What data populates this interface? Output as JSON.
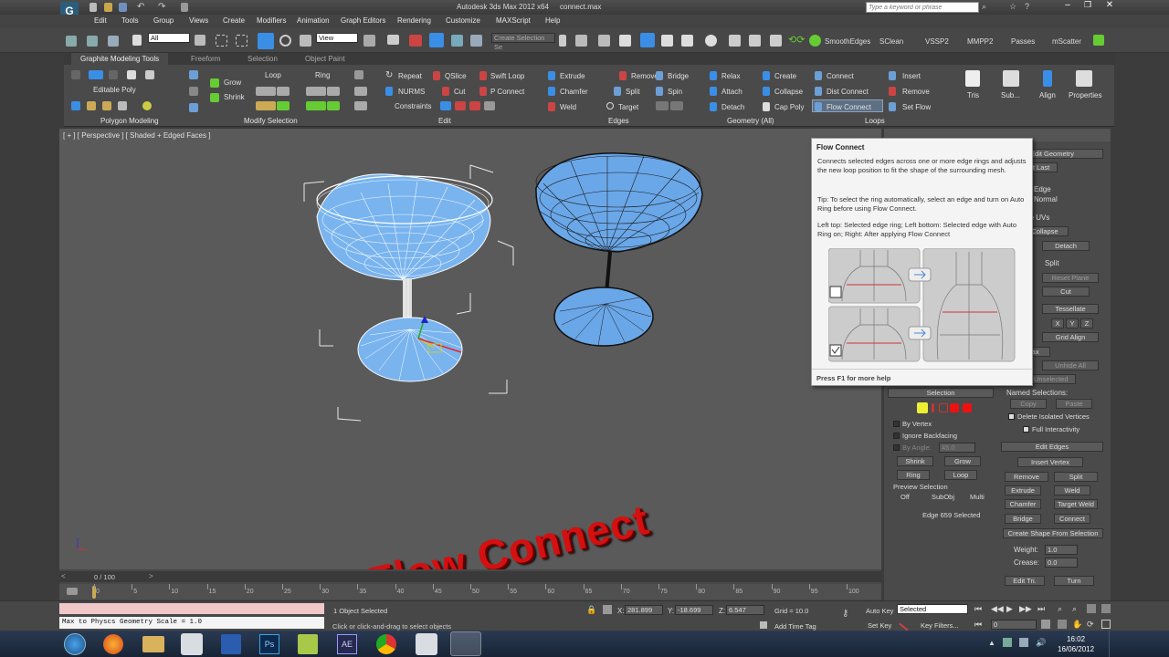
{
  "window": {
    "title": "Autodesk 3ds Max 2012 x64",
    "file": "connect.max",
    "search_placeholder": "Type a keyword or phrase"
  },
  "menu": [
    "Edit",
    "Tools",
    "Group",
    "Views",
    "Create",
    "Modifiers",
    "Animation",
    "Graph Editors",
    "Rendering",
    "Customize",
    "MAXScript",
    "Help"
  ],
  "toolbar": {
    "select_filter": "All",
    "ref_coord": "View",
    "named_sel": "Create Selection Se",
    "plugins": [
      "SmoothEdges",
      "SClean",
      "VSSP2",
      "MMPP2",
      "Passes",
      "mScatter"
    ]
  },
  "ribbon": {
    "tabs": [
      "Graphite Modeling Tools",
      "Freeform",
      "Selection",
      "Object Paint"
    ],
    "polygon_modeling": {
      "label": "Editable Poly",
      "group": "Polygon Modeling"
    },
    "modify_selection": {
      "grow": "Grow",
      "shrink": "Shrink",
      "loop": "Loop",
      "ring": "Ring",
      "group": "Modify Selection"
    },
    "edit": {
      "repeat": "Repeat",
      "qslice": "QSlice",
      "swift_loop": "Swift Loop",
      "nurms": "NURMS",
      "cut": "Cut",
      "p_connect": "P Connect",
      "constraints": "Constraints",
      "group": "Edit"
    },
    "edges": {
      "extrude": "Extrude",
      "remove": "Remove",
      "bridge": "Bridge",
      "chamfer": "Chamfer",
      "split": "Split",
      "spin": "Spin",
      "weld": "Weld",
      "target": "Target",
      "group": "Edges"
    },
    "geometry": {
      "relax": "Relax",
      "create": "Create",
      "attach": "Attach",
      "collapse": "Collapse",
      "detach": "Detach",
      "cap_poly": "Cap Poly",
      "group": "Geometry (All)"
    },
    "loops": {
      "connect": "Connect",
      "insert": "Insert",
      "dist_connect": "Dist Connect",
      "remove": "Remove",
      "flow_connect": "Flow Connect",
      "set_flow": "Set Flow",
      "group": "Loops"
    },
    "big_buttons": [
      "Tris",
      "Sub...",
      "Align",
      "Properties"
    ]
  },
  "viewport": {
    "label": "[ + ] [ Perspective ] [ Shaded + Edged Faces ]",
    "overlay_text": "Flow Connect"
  },
  "tooltip": {
    "title": "Flow Connect",
    "body": "Connects selected edges across one or more edge rings and adjusts the new loop position to fit the shape of the surrounding mesh.",
    "tip": "Tip: To select the ring automatically, select an edge and turn on Auto Ring before using Flow Connect.",
    "caption": "Left top: Selected edge ring; Left bottom: Selected edge with Auto Ring on; Right: After applying Flow Connect",
    "help": "Press F1 for more help"
  },
  "cmdpanel": {
    "edit_geometry": "Edit Geometry",
    "repeat_last": "Repeat Last",
    "edge": "Edge",
    "normal": "Normal",
    "preserve_uvs": "Preserve UVs",
    "collapse": "Collapse",
    "detach": "Detach",
    "split": "Split",
    "reset_plane": "Reset Plane",
    "cut": "Cut",
    "tessellate": "Tessellate",
    "xyz": [
      "X",
      "Y",
      "Z"
    ],
    "grid_align": "Grid Align",
    "relax": "Relax",
    "unhide_all": "Unhide All",
    "hide_unselected": "Hide Unselected",
    "named_selections": "Named Selections:",
    "copy": "Copy",
    "paste": "Paste",
    "delete_isolated": "Delete Isolated Vertices",
    "full_interactivity": "Full Interactivity",
    "selection": "Selection",
    "by_vertex": "By Vertex",
    "ignore_backfacing": "Ignore Backfacing",
    "by_angle": "By Angle:",
    "by_angle_value": "45.0",
    "shrink": "Shrink",
    "grow": "Grow",
    "ring": "Ring",
    "loop": "Loop",
    "preview_selection": "Preview Selection",
    "preview_opts": [
      "Off",
      "SubObj",
      "Multi"
    ],
    "edge_selected": "Edge 659 Selected",
    "edit_edges": "Edit Edges",
    "insert_vertex": "Insert Vertex",
    "remove": "Remove",
    "split2": "Split",
    "extrude": "Extrude",
    "weld": "Weld",
    "chamfer": "Chamfer",
    "target_weld": "Target Weld",
    "bridge": "Bridge",
    "connect": "Connect",
    "create_shape": "Create Shape From Selection",
    "weight_label": "Weight:",
    "weight": "1.0",
    "crease_label": "Crease:",
    "crease": "0.0",
    "edit_tri": "Edit Tri.",
    "turn": "Turn"
  },
  "timeline": {
    "frame": "0 / 100",
    "ticks": [
      "0",
      "5",
      "10",
      "15",
      "20",
      "25",
      "30",
      "35",
      "40",
      "45",
      "50",
      "55",
      "60",
      "65",
      "70",
      "75",
      "80",
      "85",
      "90",
      "95",
      "100"
    ]
  },
  "status": {
    "script_output": "Max to Physcs Geometry Scale = 1.0",
    "objects": "1 Object Selected",
    "prompt": "Click or click-and-drag to select objects",
    "x_label": "X:",
    "x": "281.899",
    "y_label": "Y:",
    "y": "-18.699",
    "z_label": "Z:",
    "z": "6.547",
    "grid": "Grid = 10.0",
    "add_time_tag": "Add Time Tag",
    "auto_key": "Auto Key",
    "set_key": "Set Key",
    "key_mode": "Selected",
    "key_filters": "Key Filters...",
    "current_frame": "0"
  },
  "taskbar": {
    "time": "16:02",
    "date": "16/06/2012"
  },
  "colors": {
    "accent": "#3a8ee6",
    "overlay": "#d41010",
    "mesh": "#79b4ef"
  }
}
